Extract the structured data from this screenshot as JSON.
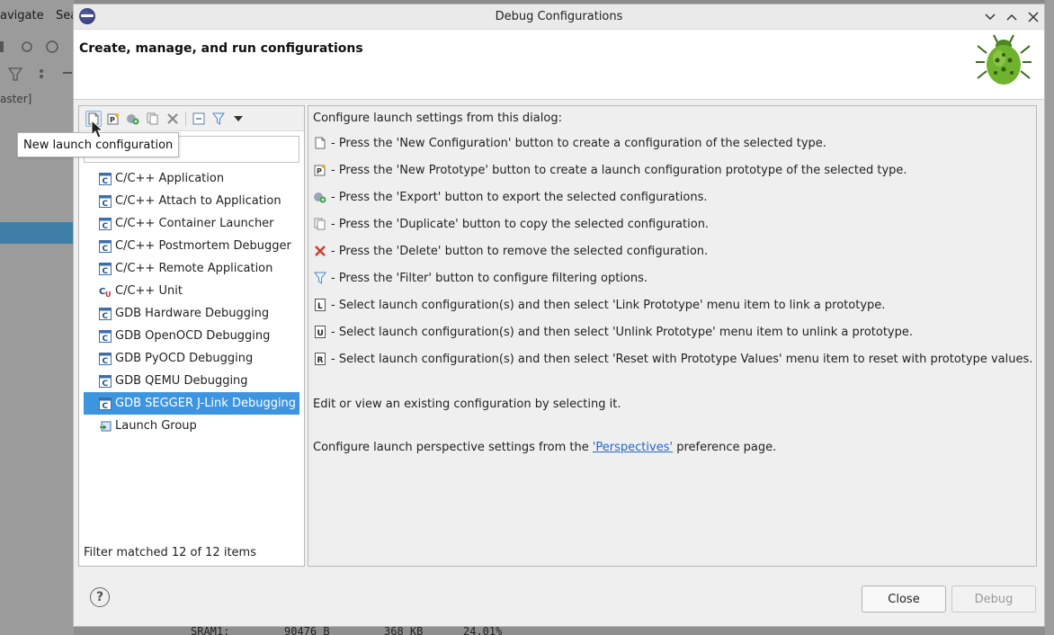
{
  "background": {
    "menu_items": [
      "avigate",
      "Sea"
    ],
    "branch_label": "aster]",
    "bottom_text": [
      "SRAM1:",
      "90476 B",
      "368 KB",
      "24.01%"
    ]
  },
  "dialog": {
    "title": "Debug Configurations",
    "heading": "Create, manage, and run configurations",
    "window_buttons": {
      "minimize": "⌄",
      "maximize": "⌃",
      "close": "✕"
    }
  },
  "left_panel": {
    "filter_placeholder": "xt",
    "tooltip": "New launch configuration",
    "tree_items": [
      {
        "label": "C/C++ Application",
        "icon": "c-app-icon"
      },
      {
        "label": "C/C++ Attach to Application",
        "icon": "c-app-icon"
      },
      {
        "label": "C/C++ Container Launcher",
        "icon": "c-app-icon"
      },
      {
        "label": "C/C++ Postmortem Debugger",
        "icon": "c-app-icon"
      },
      {
        "label": "C/C++ Remote Application",
        "icon": "c-app-icon"
      },
      {
        "label": "C/C++ Unit",
        "icon": "c-unit-icon"
      },
      {
        "label": "GDB Hardware Debugging",
        "icon": "c-app-icon"
      },
      {
        "label": "GDB OpenOCD Debugging",
        "icon": "c-app-icon"
      },
      {
        "label": "GDB PyOCD Debugging",
        "icon": "c-app-icon"
      },
      {
        "label": "GDB QEMU Debugging",
        "icon": "c-app-icon"
      },
      {
        "label": "GDB SEGGER J-Link Debugging",
        "icon": "c-app-icon",
        "selected": true
      },
      {
        "label": "Launch Group",
        "icon": "launch-group-icon"
      }
    ],
    "filter_status": "Filter matched 12 of 12 items"
  },
  "right_panel": {
    "intro": "Configure launch settings from this dialog:",
    "lines": [
      {
        "icon": "new-config-icon",
        "text": "- Press the 'New Configuration' button to create a configuration of the selected type."
      },
      {
        "icon": "new-prototype-icon",
        "text": "- Press the 'New Prototype' button to create a launch configuration prototype of the selected type."
      },
      {
        "icon": "export-icon",
        "text": "- Press the 'Export' button to export the selected configurations."
      },
      {
        "icon": "duplicate-icon",
        "text": "- Press the 'Duplicate' button to copy the selected configuration."
      },
      {
        "icon": "delete-icon",
        "text": "- Press the 'Delete' button to remove the selected configuration."
      },
      {
        "icon": "filter-icon",
        "text": "- Press the 'Filter' button to configure filtering options."
      },
      {
        "icon": "link-prototype-icon",
        "text": "- Select launch configuration(s) and then select 'Link Prototype' menu item to link a prototype."
      },
      {
        "icon": "unlink-prototype-icon",
        "text": "- Select launch configuration(s) and then select 'Unlink Prototype' menu item to unlink a prototype."
      },
      {
        "icon": "reset-prototype-icon",
        "text": "- Select launch configuration(s) and then select 'Reset with Prototype Values' menu item to reset with prototype values."
      }
    ],
    "edit_text": "Edit or view an existing configuration by selecting it.",
    "perspective_prefix": "Configure launch perspective settings from the ",
    "perspective_link": "'Perspectives'",
    "perspective_suffix": " preference page."
  },
  "buttons": {
    "help": "?",
    "close": "Close",
    "debug": "Debug"
  }
}
